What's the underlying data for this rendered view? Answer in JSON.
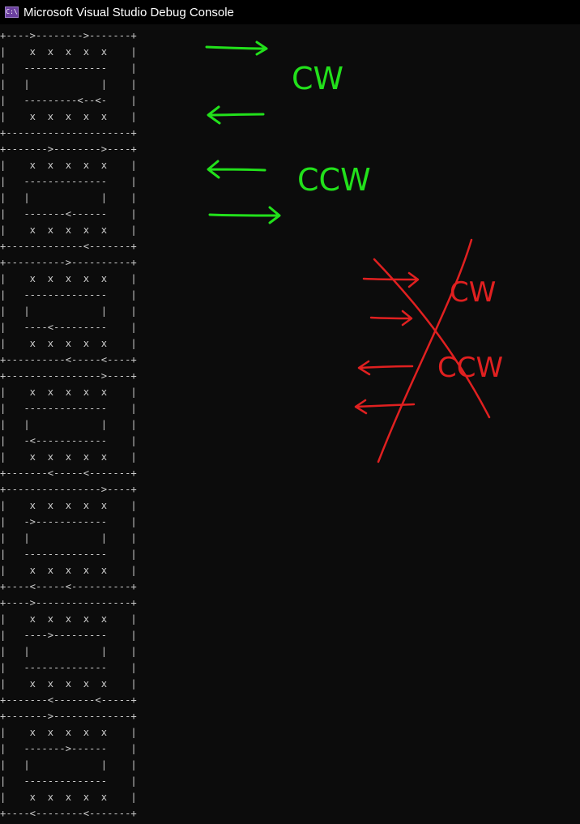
{
  "window": {
    "title": "Microsoft Visual Studio Debug Console",
    "icon": "console-app-icon",
    "icon_glyph": "C:\\"
  },
  "console": {
    "lines": [
      "+---->-------->-------+",
      "|    x  x  x  x  x    |",
      "|   --------------    |",
      "|   |            |    |",
      "|   ---------<--<-    |",
      "|    x  x  x  x  x    |",
      "+---------------------+",
      "+------->-------->----+",
      "|    x  x  x  x  x    |",
      "|   --------------    |",
      "|   |            |    |",
      "|   -------<------    |",
      "|    x  x  x  x  x    |",
      "+-------------<-------+",
      "+---------->----------+",
      "|    x  x  x  x  x    |",
      "|   --------------    |",
      "|   |            |    |",
      "|   ----<---------    |",
      "|    x  x  x  x  x    |",
      "+----------<-----<----+",
      "+---------------->----+",
      "|    x  x  x  x  x    |",
      "|   --------------    |",
      "|   |            |    |",
      "|   -<------------    |",
      "|    x  x  x  x  x    |",
      "+-------<-----<-------+",
      "+---------------->----+",
      "|    x  x  x  x  x    |",
      "|   ->------------    |",
      "|   |            |    |",
      "|   --------------    |",
      "|    x  x  x  x  x    |",
      "+----<-----<----------+",
      "+---->----------------+",
      "|    x  x  x  x  x    |",
      "|   ---->---------    |",
      "|   |            |    |",
      "|   --------------    |",
      "|    x  x  x  x  x    |",
      "+-------<-------<-----+",
      "+------->-------------+",
      "|    x  x  x  x  x    |",
      "|   ------->------    |",
      "|   |            |    |",
      "|   --------------    |",
      "|    x  x  x  x  x    |",
      "+----<--------<-------+",
      "       .       ."
    ]
  },
  "annotations": {
    "green_labels": [
      "CW",
      "CCW"
    ],
    "red_labels": [
      "CW",
      "CCW"
    ],
    "colors": {
      "green": "#22e11b",
      "red": "#e02020",
      "console_background": "#0c0c0c",
      "console_text": "#cccccc"
    }
  }
}
